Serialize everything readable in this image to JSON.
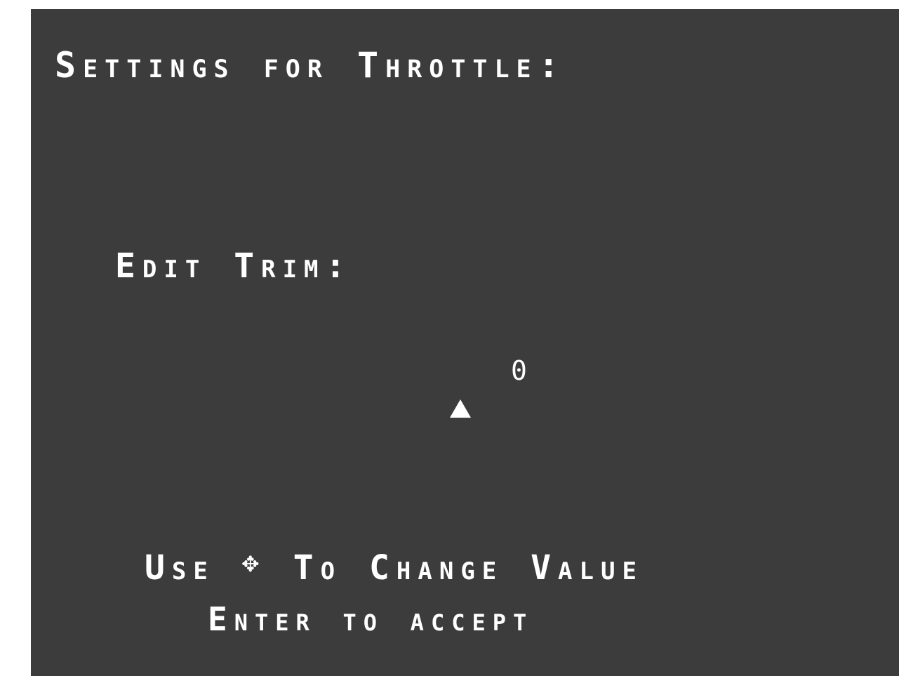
{
  "screen": {
    "background_color": "#3c3c3c",
    "text_color": "#ffffff"
  },
  "header": {
    "title": "Settings for Throttle:"
  },
  "trim": {
    "label": "Edit Trim:",
    "value": "0",
    "marker_icon": "triangle-up-icon"
  },
  "help": {
    "use_label": "Use",
    "dpad_icon_name": "dpad-icon",
    "dpad_glyph": "✥",
    "change_label": "To Change Value",
    "accept_label": "Enter to accept"
  }
}
